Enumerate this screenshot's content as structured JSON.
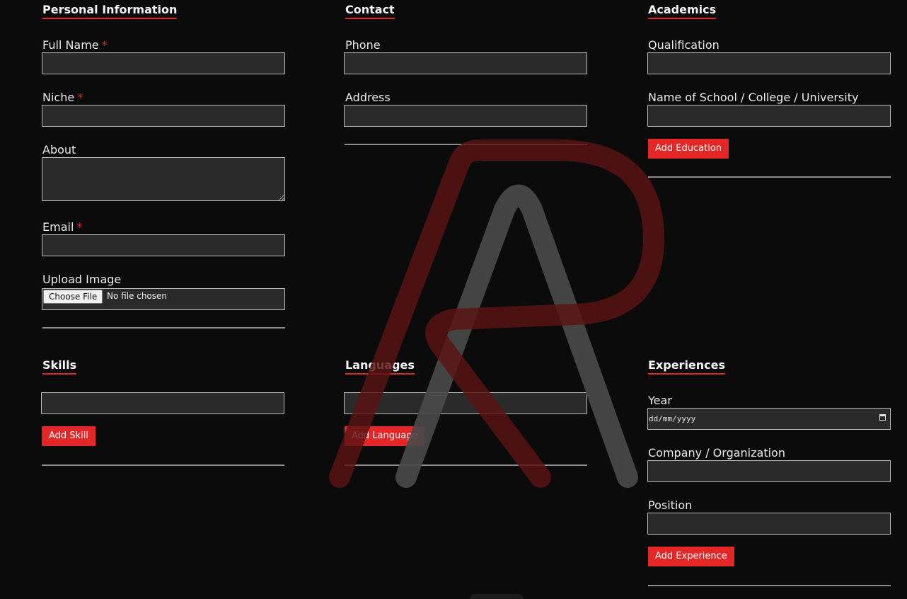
{
  "personal": {
    "title": "Personal Information",
    "full_name_label": "Full Name",
    "niche_label": "Niche",
    "about_label": "About",
    "email_label": "Email",
    "upload_label": "Upload Image",
    "required_mark": "*",
    "file_button": "Choose File",
    "file_status": "No file chosen"
  },
  "contact": {
    "title": "Contact",
    "phone_label": "Phone",
    "address_label": "Address"
  },
  "academics": {
    "title": "Academics",
    "qualification_label": "Qualification",
    "school_label": "Name of School / College / University",
    "add_button": "Add Education"
  },
  "skills": {
    "title": "Skills",
    "add_button": "Add Skill"
  },
  "languages": {
    "title": "Languages",
    "add_button": "Add Language"
  },
  "experiences": {
    "title": "Experiences",
    "year_label": "Year",
    "year_placeholder": "dd/mm/yyyy",
    "company_label": "Company / Organization",
    "position_label": "Position",
    "add_button": "Add Experience"
  },
  "colors": {
    "background": "#0b0b0b",
    "accent": "#e32626",
    "input_bg": "#2a2a2a",
    "input_border": "#bdbdbd",
    "watermark_red": "#5a1313",
    "watermark_gray": "#4a4a4a"
  },
  "icons": {
    "logo": "ar-monogram-logo",
    "date_picker": "calendar-icon"
  }
}
